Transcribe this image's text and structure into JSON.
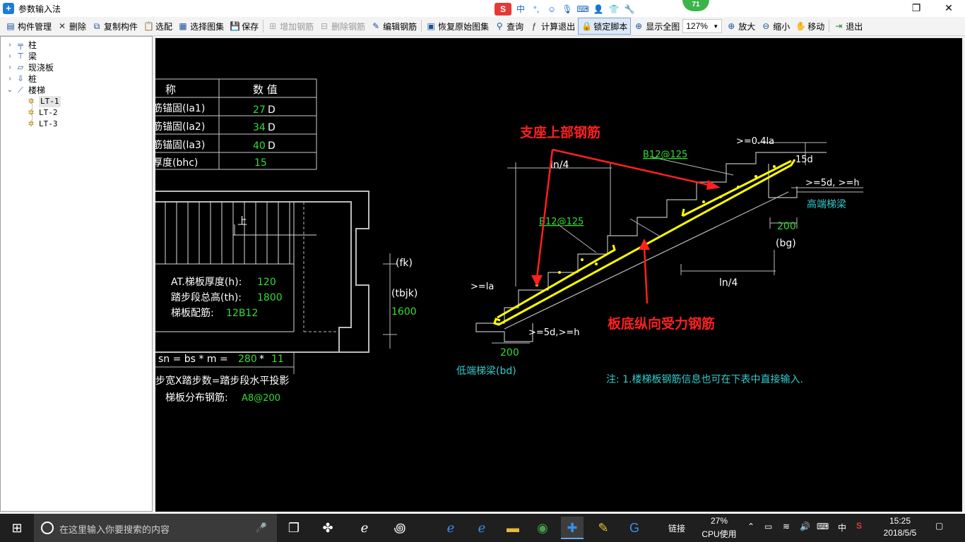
{
  "window": {
    "title": "参数输入法",
    "restore_glyph": "❐",
    "close_glyph": "✕"
  },
  "ime_bar": {
    "logo": "S",
    "lang": "中",
    "punct": "°,",
    "emoji": "☺",
    "voice": "🎙",
    "keyboard": "⌨",
    "user": "👤",
    "shirt": "👕",
    "tool": "🔧"
  },
  "notification_badge": "71",
  "toolbar": {
    "component_manage": "构件管理",
    "delete": "删除",
    "copy_component": "复制构件",
    "select_config": "选配",
    "select_atlas": "选择图集",
    "save": "保存",
    "add_rebar": "增加钢筋",
    "delete_rebar": "删除钢筋",
    "edit_rebar": "编辑钢筋",
    "restore_atlas": "恢复原始图集",
    "query": "查询",
    "calc_exit": "计算退出",
    "lock_script": "锁定脚本",
    "show_all": "显示全图",
    "zoom_level": "127%",
    "zoom_in": "放大",
    "zoom_out": "缩小",
    "move": "移动",
    "exit": "退出"
  },
  "tree": {
    "column": "柱",
    "beam": "梁",
    "slab": "现浇板",
    "pile": "桩",
    "stair": "楼梯",
    "children": [
      "LT-1",
      "LT-2",
      "LT-3"
    ]
  },
  "drawing": {
    "table_header": {
      "name_col": "称",
      "value_col": "数  值"
    },
    "table_rows": [
      {
        "name": "筋锚固(la1)",
        "value": "27",
        "unit": "D"
      },
      {
        "name": "筋锚固(la2)",
        "value": "34",
        "unit": "D"
      },
      {
        "name": "筋锚固(la3)",
        "value": "40",
        "unit": "D"
      },
      {
        "name": "厚度(bhc)",
        "value": "15",
        "unit": ""
      }
    ],
    "plan_up_label": "上",
    "info": {
      "thickness_label": "AT.梯板厚度(h):",
      "thickness_value": "120",
      "height_label": "踏步段总高(th):",
      "height_value": "1800",
      "rebar_label": "梯板配筋:",
      "rebar_value": "12B12"
    },
    "fk": "(fk)",
    "tbjk": "(tbjk)",
    "tbjk_value": "1600",
    "formula": "sn = bs * m = ",
    "formula_a": "280",
    "formula_op": "*",
    "formula_b": "11",
    "formula_text": "步宽X踏步数=踏步段水平投影",
    "dist_label": "梯板分布钢筋:",
    "dist_value": "A8@200",
    "support_top_label": "支座上部钢筋",
    "bottom_rebar_label": "板底纵向受力钢筋",
    "ln4_top": "ln/4",
    "ln4_bottom": "ln/4",
    "b12_top": "B12@125",
    "b12_mid": "B12@125",
    "gt04la": ">=0.4la",
    "d15": "15d",
    "gt5d_h_top": ">=5d, >=h",
    "high_beam": "高端梯梁",
    "bg_value": "200",
    "bg_label": "(bg)",
    "gt_la": ">=la",
    "gt5d_h_bottom": ">=5d,>=h",
    "bd_value": "200",
    "low_beam": "低端梯梁(bd)",
    "note": "注: 1.楼梯板钢筋信息也可在下表中直接输入."
  },
  "taskbar": {
    "search_placeholder": "在这里输入你要搜索的内容",
    "link_label": "链接",
    "cpu_percent": "27%",
    "cpu_label": "CPU使用",
    "ime_lang": "中",
    "time": "15:25",
    "date": "2018/5/5"
  },
  "colors": {
    "canvas_bg": "#000000",
    "yellow_rebar": "#ffff00",
    "red_label": "#ff2020",
    "green_value": "#33dd33",
    "cyan_label": "#33cccc"
  }
}
